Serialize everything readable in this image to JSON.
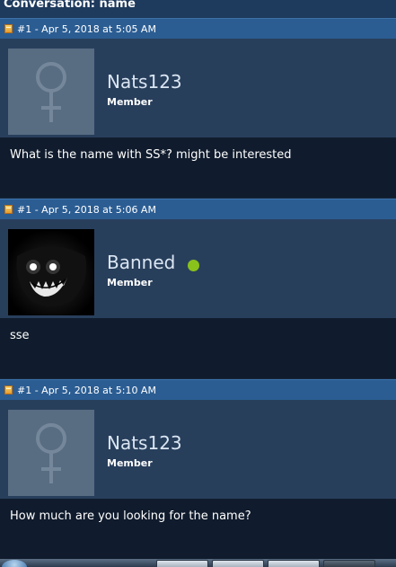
{
  "conversation": {
    "title": "Conversation: name"
  },
  "posts": [
    {
      "header": "#1 - Apr 5, 2018 at 5:05 AM",
      "username": "Nats123",
      "role": "Member",
      "avatar": "female-symbol-avatar",
      "online": false,
      "message": "What is the name with SS*? might be interested"
    },
    {
      "header": "#1 - Apr 5, 2018 at 5:06 AM",
      "username": "Banned",
      "role": "Member",
      "avatar": "grinning-monster-avatar",
      "online": true,
      "message": "sse"
    },
    {
      "header": "#1 - Apr 5, 2018 at 5:10 AM",
      "username": "Nats123",
      "role": "Member",
      "avatar": "female-symbol-avatar",
      "online": false,
      "message": "How much are you looking for the name?"
    }
  ],
  "colors": {
    "header_bar": "#2b5d93",
    "user_panel": "#283f5c",
    "message_bg": "#101c2d",
    "online_indicator": "#8ac21c"
  },
  "icons": {
    "post_header": "post-document-icon",
    "status": "online-status-icon"
  }
}
